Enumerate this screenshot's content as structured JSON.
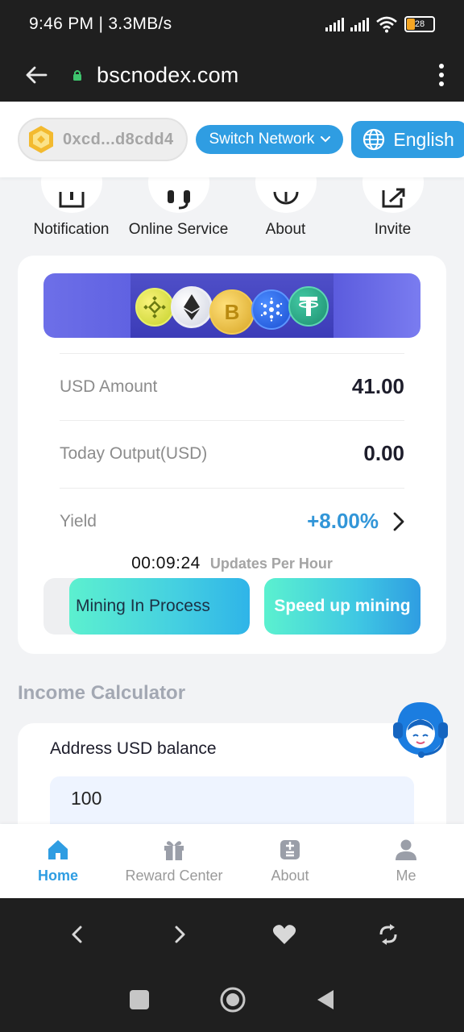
{
  "status_bar": {
    "time_speed": "9:46 PM | 3.3MB/s",
    "battery_level": "28",
    "battery_color": "#f5a623"
  },
  "browser": {
    "domain": "bscnodex.com",
    "icons": {
      "back": "arrow-left-icon",
      "lock": "lock-icon",
      "menu": "more-vertical-icon"
    }
  },
  "header": {
    "wallet_address": "0xcd...d8cdd4",
    "wallet_icon": "bnb-logo-icon",
    "switch_network_label": "Switch Network",
    "language_label": "English",
    "accent_color": "#2f9de2"
  },
  "quick_actions": [
    {
      "label": "Notification",
      "icon": "notification-icon"
    },
    {
      "label": "Online Service",
      "icon": "headset-icon"
    },
    {
      "label": "About",
      "icon": "info-icon"
    },
    {
      "label": "Invite",
      "icon": "share-icon"
    }
  ],
  "mining": {
    "banner_coins": [
      "BNB",
      "ETH",
      "BTC",
      "ADA",
      "USDT"
    ],
    "usd_amount_label": "USD Amount",
    "usd_amount_value": "41.00",
    "today_output_label": "Today Output(USD)",
    "today_output_value": "0.00",
    "yield_label": "Yield",
    "yield_value": "+8.00%",
    "countdown": "00:09:24",
    "updates_label": "Updates Per Hour",
    "status_label": "Mining In Process",
    "speed_up_label": "Speed up mining"
  },
  "calculator": {
    "title": "Income Calculator",
    "balance_label": "Address USD balance",
    "balance_value": "100"
  },
  "bottom_nav": [
    {
      "label": "Home",
      "icon": "home-icon",
      "active": true
    },
    {
      "label": "Reward Center",
      "icon": "gift-icon",
      "active": false
    },
    {
      "label": "About",
      "icon": "about-icon",
      "active": false
    },
    {
      "label": "Me",
      "icon": "user-icon",
      "active": false
    }
  ],
  "browser_toolbar": {
    "icons": [
      "chevron-left-icon",
      "chevron-right-icon",
      "heart-icon",
      "refresh-icon"
    ]
  },
  "android_nav": {
    "icons": [
      "recents-icon",
      "home-circle-icon",
      "back-triangle-icon"
    ]
  }
}
